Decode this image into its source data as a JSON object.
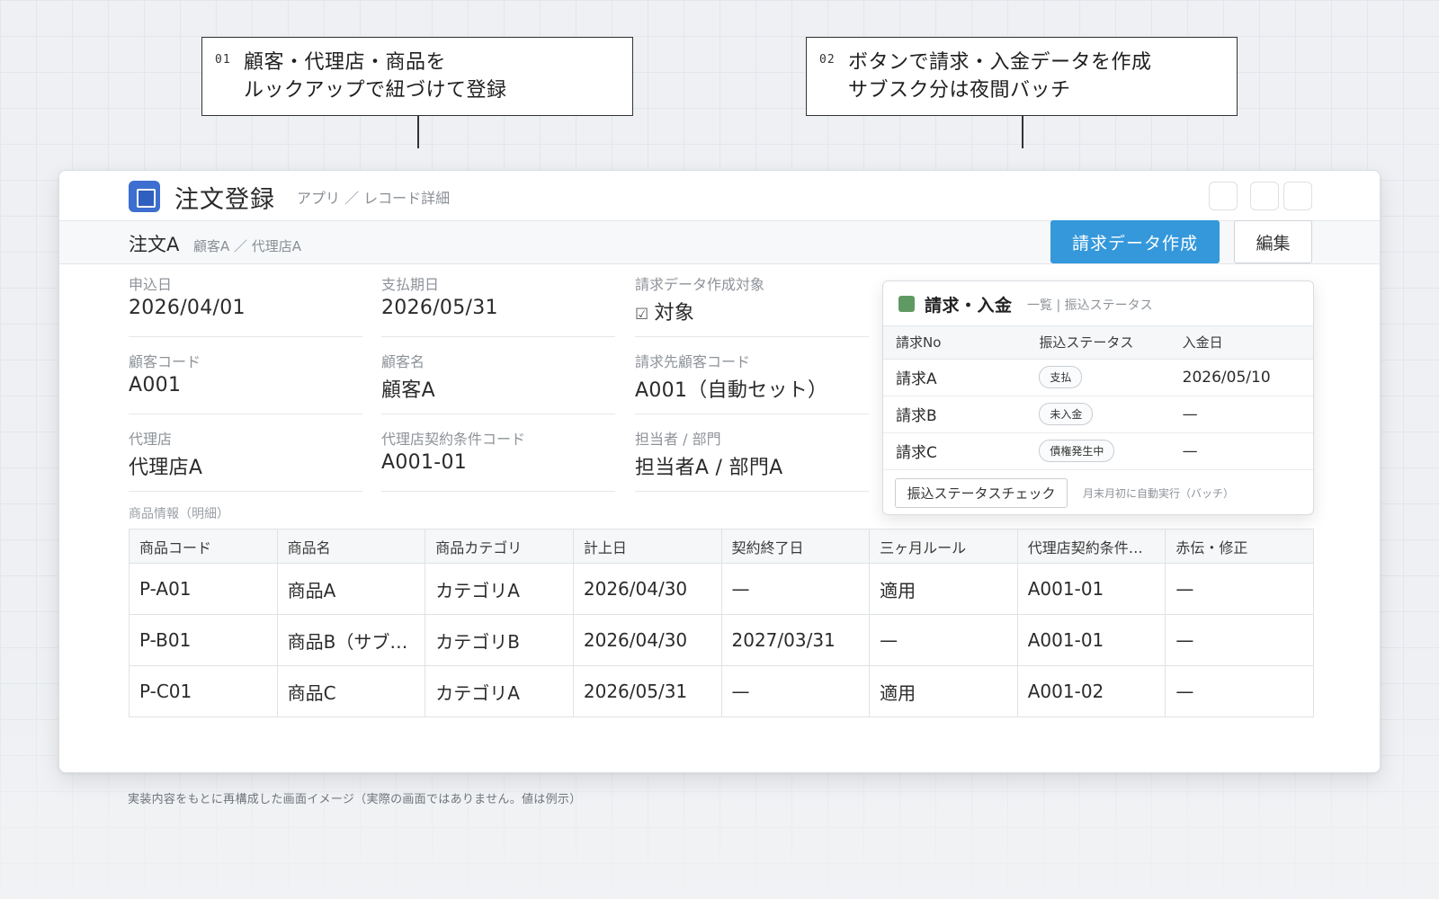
{
  "callouts": [
    {
      "num": "01",
      "line1": "顧客・代理店・商品を",
      "line2": "ルックアップで紐づけて登録"
    },
    {
      "num": "02",
      "line1": "ボタンで請求・入金データを作成",
      "line2": "サブスク分は夜間バッチ"
    }
  ],
  "app": {
    "title": "注文登録",
    "breadcrumb": "アプリ ／ レコード詳細"
  },
  "record": {
    "title": "注文A",
    "subtitle": "顧客A ／ 代理店A",
    "create_button": "請求データ作成",
    "edit_button": "編集"
  },
  "fields": {
    "apply_date": {
      "label": "申込日",
      "value": "2026/04/01"
    },
    "payment_due": {
      "label": "支払期日",
      "value": "2026/05/31"
    },
    "billing_target": {
      "label": "請求データ作成対象",
      "check": "☑",
      "value": "対象"
    },
    "customer_code": {
      "label": "顧客コード",
      "value": "A001"
    },
    "customer_name": {
      "label": "顧客名",
      "value": "顧客A"
    },
    "billing_customer_code": {
      "label": "請求先顧客コード",
      "value": "A001（自動セット）"
    },
    "agency": {
      "label": "代理店",
      "value": "代理店A"
    },
    "agency_contract_code": {
      "label": "代理店契約条件コード",
      "value": "A001-01"
    },
    "staff_dept": {
      "label": "担当者 / 部門",
      "value": "担当者A / 部門A"
    }
  },
  "products": {
    "section_label": "商品情報（明細）",
    "headers": [
      "商品コード",
      "商品名",
      "商品カテゴリ",
      "計上日",
      "契約終了日",
      "三ヶ月ルール",
      "代理店契約条件…",
      "赤伝・修正"
    ],
    "rows": [
      [
        "P-A01",
        "商品A",
        "カテゴリA",
        "2026/04/30",
        "—",
        "適用",
        "A001-01",
        "—"
      ],
      [
        "P-B01",
        "商品B（サブ…",
        "カテゴリB",
        "2026/04/30",
        "2027/03/31",
        "—",
        "A001-01",
        "—"
      ],
      [
        "P-C01",
        "商品C",
        "カテゴリA",
        "2026/05/31",
        "—",
        "適用",
        "A001-02",
        "—"
      ]
    ]
  },
  "billing_panel": {
    "title": "請求・入金",
    "subtitle": "一覧 | 振込ステータス",
    "headers": [
      "請求No",
      "振込ステータス",
      "入金日"
    ],
    "rows": [
      {
        "no": "請求A",
        "status": "支払",
        "date": "2026/05/10"
      },
      {
        "no": "請求B",
        "status": "未入金",
        "date": "—"
      },
      {
        "no": "請求C",
        "status": "債権発生中",
        "date": "—"
      }
    ],
    "check_button": "振込ステータスチェック",
    "note": "月末月初に自動実行（バッチ）"
  },
  "footnote": "実装内容をもとに再構成した画面イメージ（実際の画面ではありません。値は例示）",
  "colors": {
    "primary_button": "#3498db",
    "app_icon": "#3c6fd0",
    "panel_icon": "#5f9a63"
  }
}
